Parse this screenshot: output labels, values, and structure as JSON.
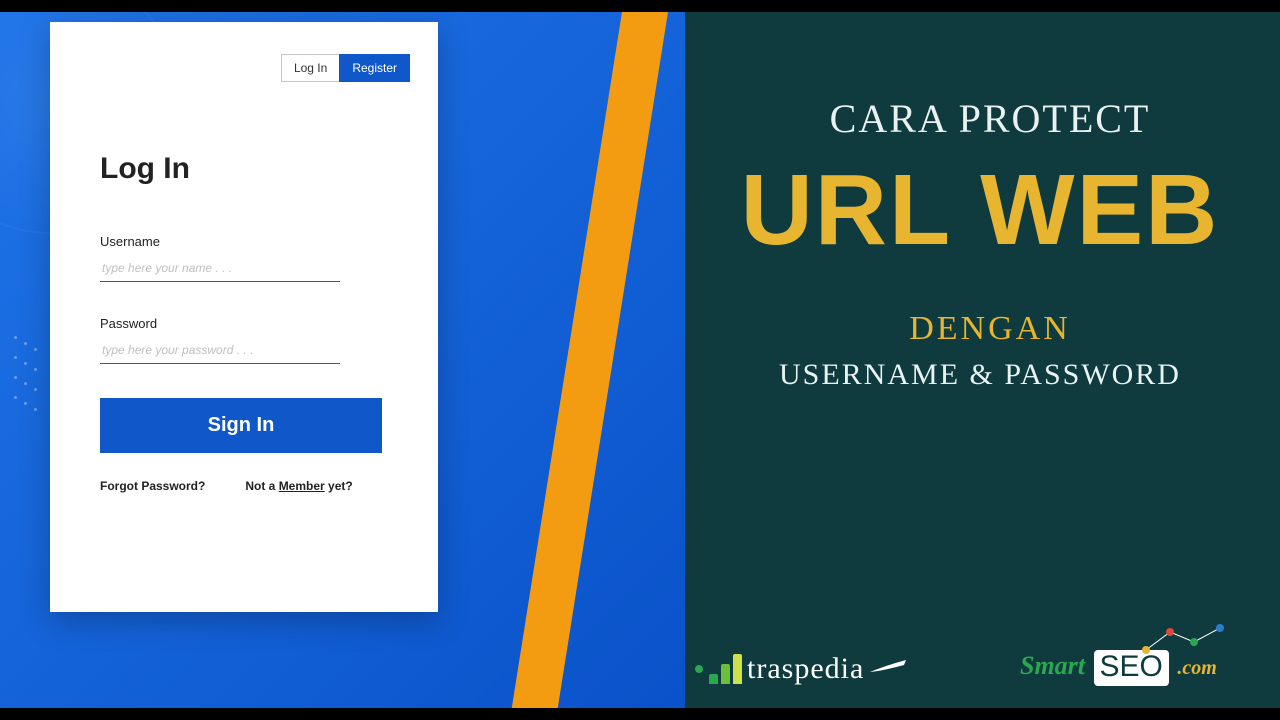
{
  "left": {
    "tabs": {
      "login": "Log In",
      "register": "Register"
    },
    "title": "Log In",
    "username": {
      "label": "Username",
      "placeholder": "type here your name . . ."
    },
    "password": {
      "label": "Password",
      "placeholder": "type here your password . . ."
    },
    "submit": "Sign In",
    "forgot": "Forgot Password?",
    "not_member_prefix": "Not a ",
    "not_member_link": "Member",
    "not_member_suffix": " yet?"
  },
  "headline": {
    "line1": "CARA PROTECT",
    "line2": "URL WEB",
    "line3": "DENGAN",
    "line4": "USERNAME & PASSWORD"
  },
  "logos": {
    "traspedia": "traspedia",
    "smartseo_smart": "Smart",
    "smartseo_seo": "SEO",
    "smartseo_com": ".com"
  },
  "colors": {
    "blue": "#1058c9",
    "orange": "#f39c12",
    "gold": "#e7b530",
    "teal": "#0f3b3f",
    "green": "#2aa84f"
  }
}
